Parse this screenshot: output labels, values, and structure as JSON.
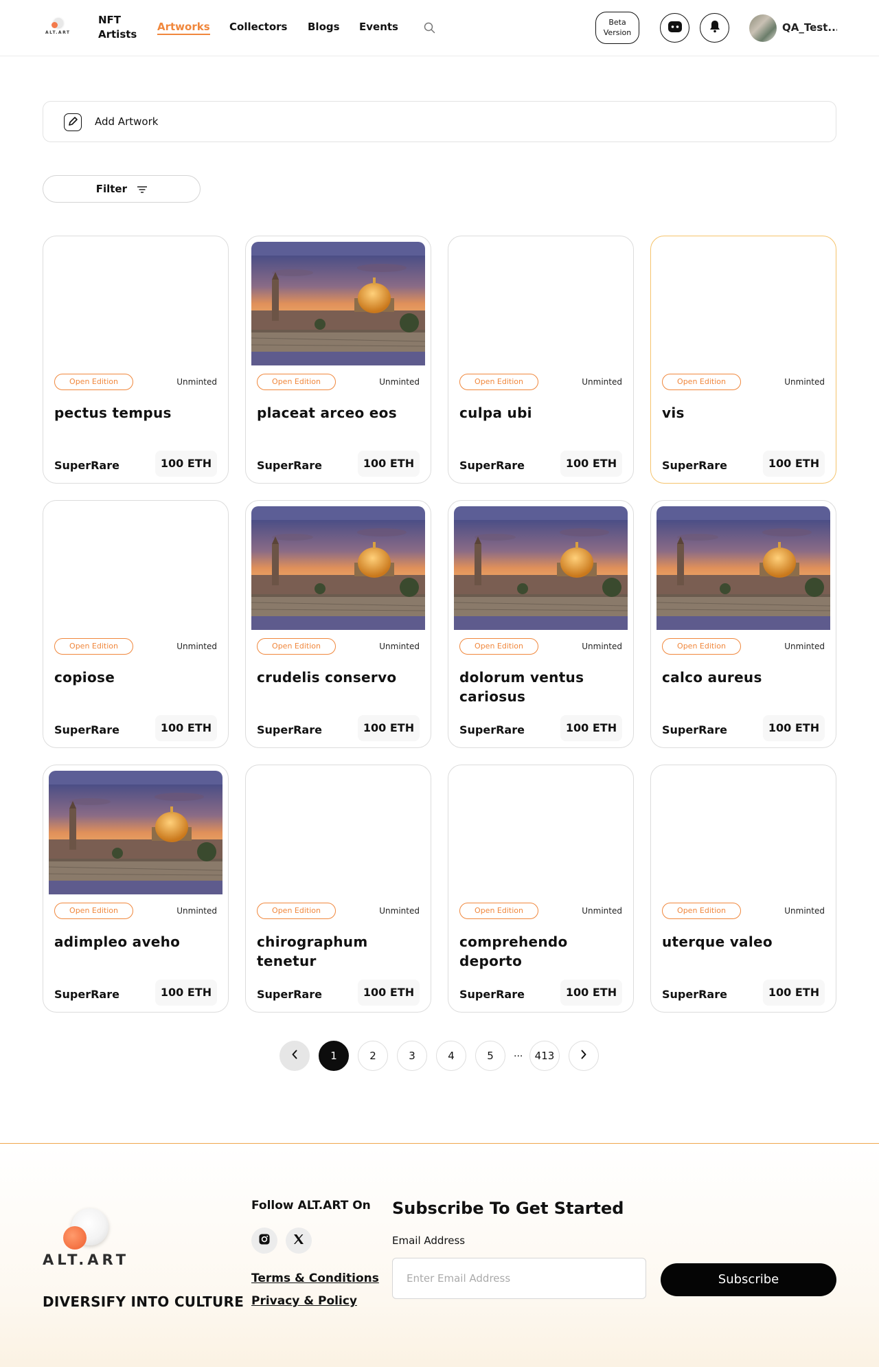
{
  "header": {
    "brand": "ALT.ART",
    "nav_title": "NFT Artists",
    "nav": [
      {
        "label": "Artworks",
        "active": true
      },
      {
        "label": "Collectors",
        "active": false
      },
      {
        "label": "Blogs",
        "active": false
      },
      {
        "label": "Events",
        "active": false
      }
    ],
    "beta_label": "Beta Version",
    "user_name": "QA_Test..."
  },
  "add_artwork_label": "Add Artwork",
  "filter_label": "Filter",
  "cards": [
    {
      "title": "pectus tempus",
      "badge": "Open Edition",
      "status": "Unminted",
      "market": "SuperRare",
      "price": "100 ETH",
      "has_image": false,
      "highlight": false
    },
    {
      "title": "placeat arceo eos",
      "badge": "Open Edition",
      "status": "Unminted",
      "market": "SuperRare",
      "price": "100 ETH",
      "has_image": true,
      "highlight": false
    },
    {
      "title": "culpa ubi",
      "badge": "Open Edition",
      "status": "Unminted",
      "market": "SuperRare",
      "price": "100 ETH",
      "has_image": false,
      "highlight": false
    },
    {
      "title": "vis",
      "badge": "Open Edition",
      "status": "Unminted",
      "market": "SuperRare",
      "price": "100 ETH",
      "has_image": false,
      "highlight": true
    },
    {
      "title": "copiose",
      "badge": "Open Edition",
      "status": "Unminted",
      "market": "SuperRare",
      "price": "100 ETH",
      "has_image": false,
      "highlight": false
    },
    {
      "title": "crudelis conservo",
      "badge": "Open Edition",
      "status": "Unminted",
      "market": "SuperRare",
      "price": "100 ETH",
      "has_image": true,
      "highlight": false
    },
    {
      "title": "dolorum ventus cariosus",
      "badge": "Open Edition",
      "status": "Unminted",
      "market": "SuperRare",
      "price": "100 ETH",
      "has_image": true,
      "highlight": false
    },
    {
      "title": "calco aureus",
      "badge": "Open Edition",
      "status": "Unminted",
      "market": "SuperRare",
      "price": "100 ETH",
      "has_image": true,
      "highlight": false
    },
    {
      "title": "adimpleo aveho",
      "badge": "Open Edition",
      "status": "Unminted",
      "market": "SuperRare",
      "price": "100 ETH",
      "has_image": true,
      "highlight": false
    },
    {
      "title": "chirographum tenetur",
      "badge": "Open Edition",
      "status": "Unminted",
      "market": "SuperRare",
      "price": "100 ETH",
      "has_image": false,
      "highlight": false
    },
    {
      "title": "comprehendo deporto",
      "badge": "Open Edition",
      "status": "Unminted",
      "market": "SuperRare",
      "price": "100 ETH",
      "has_image": false,
      "highlight": false
    },
    {
      "title": "uterque valeo",
      "badge": "Open Edition",
      "status": "Unminted",
      "market": "SuperRare",
      "price": "100 ETH",
      "has_image": false,
      "highlight": false
    }
  ],
  "pagination": {
    "pages": [
      "1",
      "2",
      "3",
      "4",
      "5"
    ],
    "current": "1",
    "ellipsis": "...",
    "last": "413"
  },
  "footer": {
    "brand": "ALT.ART",
    "slogan": "DIVERSIFY INTO CULTURE",
    "follow": "Follow ALT.ART On",
    "links": [
      "Terms & Conditions",
      "Privacy & Policy"
    ],
    "subscribe_title": "Subscribe To Get Started",
    "email_label": "Email Address",
    "email_placeholder": "Enter Email Address",
    "subscribe_button": "Subscribe"
  },
  "colors": {
    "accent": "#f0873c",
    "highlight_border": "#f5c36b",
    "dark": "#050505"
  }
}
